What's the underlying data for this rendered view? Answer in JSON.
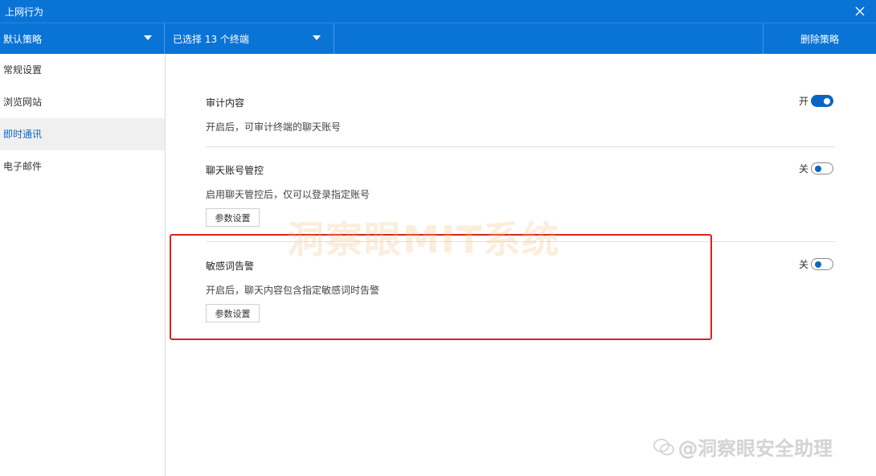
{
  "window": {
    "title": "上网行为"
  },
  "toolbar": {
    "policy_label": "默认策略",
    "terminals_label": "已选择 13 个终端",
    "delete_label": "删除策略"
  },
  "sidebar": {
    "items": [
      {
        "label": "常规设置",
        "active": false
      },
      {
        "label": "浏览网站",
        "active": false
      },
      {
        "label": "即时通讯",
        "active": true
      },
      {
        "label": "电子邮件",
        "active": false
      }
    ]
  },
  "main": {
    "settings": [
      {
        "name": "审计内容",
        "description": "开启后，可审计终端的聊天账号",
        "state_label": "开",
        "enabled": true
      },
      {
        "name": "聊天账号管控",
        "description": "启用聊天管控后，仅可以登录指定账号",
        "state_label": "关",
        "enabled": false,
        "param_label": "参数设置"
      },
      {
        "name": "敏感词告警",
        "description": "开启后，聊天内容包含指定敏感词时告警",
        "state_label": "关",
        "enabled": false,
        "param_label": "参数设置"
      }
    ]
  },
  "overlay": {
    "watermark": "洞察眼MIT系统",
    "credit": "@洞察眼安全助理"
  },
  "colors": {
    "accent": "#0a74d6",
    "toggle_on": "#0a66c2",
    "highlight_border": "#d9241b"
  }
}
